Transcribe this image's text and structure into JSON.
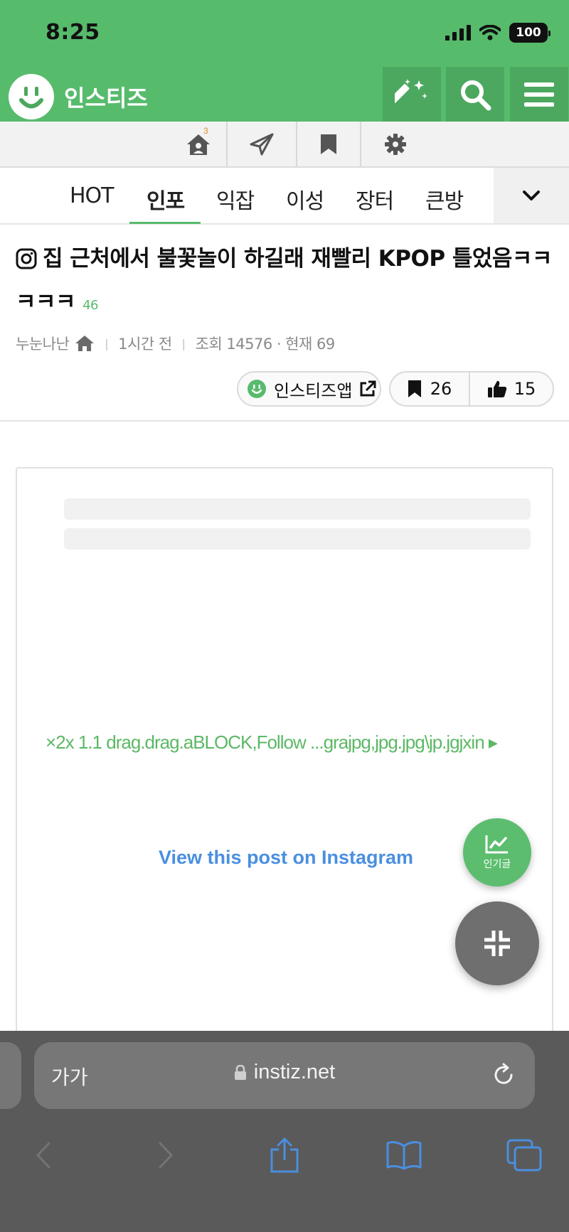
{
  "status": {
    "time": "8:25",
    "battery": "100"
  },
  "app": {
    "name": "인스티즈",
    "accent": "#57bb6c"
  },
  "header_buttons": [
    {
      "name": "magic-wand-icon"
    },
    {
      "name": "search-icon"
    },
    {
      "name": "menu-icon"
    }
  ],
  "subnav": {
    "home_badge": "3"
  },
  "tabs": [
    {
      "label": "HOT",
      "active": false
    },
    {
      "label": "인포",
      "active": true
    },
    {
      "label": "익잡",
      "active": false
    },
    {
      "label": "이성",
      "active": false
    },
    {
      "label": "장터",
      "active": false
    },
    {
      "label": "큰방",
      "active": false
    }
  ],
  "post": {
    "title": "집 근처에서 불꽃놀이 하길래 재빨리 KPOP 틀었음ㅋㅋㅋㅋㅋ",
    "comment_count": "46",
    "author": "누눈나난",
    "time_ago": "1시간 전",
    "views": "조회 14576 · 현재 69",
    "app_link_label": "인스티즈앱",
    "bookmarks": "26",
    "likes": "15"
  },
  "embed": {
    "glitch_text": "×2x 1.1 drag.drag.aBLOCK,Follow ...grajpg,jpg.jpg\\jp.jgjxin ▸",
    "view_link": "View this post on Instagram"
  },
  "fabs": {
    "popular_label": "인기글"
  },
  "browser": {
    "text_size_label": "가가",
    "url": "instiz.net"
  }
}
